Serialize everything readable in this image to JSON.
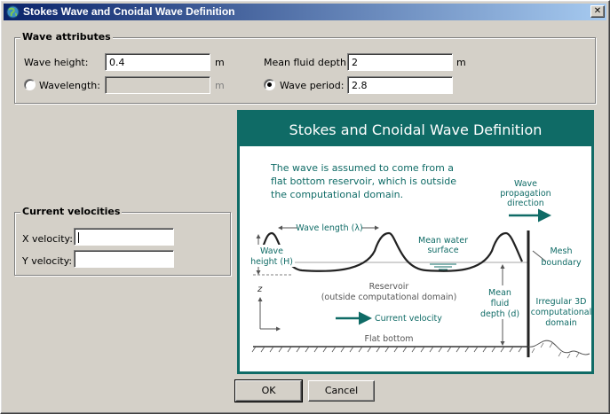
{
  "window": {
    "title": "Stokes Wave and Cnoidal Wave Definition",
    "close_glyph": "✕"
  },
  "wave_attributes": {
    "group_label": "Wave attributes",
    "wave_height": {
      "label": "Wave height:",
      "value": "0.4",
      "unit": "m"
    },
    "wavelength": {
      "label": "Wavelength:",
      "value": "",
      "unit": "m",
      "selected": false
    },
    "mean_fluid_depth": {
      "label": "Mean fluid depth:",
      "value": "2",
      "unit": "m"
    },
    "wave_period": {
      "label": "Wave period:",
      "value": "2.8",
      "selected": true
    }
  },
  "current_velocities": {
    "group_label": "Current velocities",
    "x_velocity": {
      "label": "X velocity:",
      "value": ""
    },
    "y_velocity": {
      "label": "Y velocity:",
      "value": ""
    }
  },
  "figure": {
    "title": "Stokes and Cnoidal Wave Definition",
    "description_lines": [
      "The wave is assumed to come from a",
      "flat bottom reservoir, which is outside",
      "the computational domain."
    ],
    "propagation_lines": [
      "Wave",
      "propagation",
      "direction"
    ],
    "wave_length_label": "Wave length (λ)",
    "mean_water_surface_lines": [
      "Mean water",
      "surface"
    ],
    "mesh_boundary_lines": [
      "Mesh",
      "boundary"
    ],
    "wave_height_lines": [
      "Wave",
      "height (H)"
    ],
    "reservoir_lines": [
      "Reservoir",
      "(outside computational domain)"
    ],
    "mean_fluid_depth_lines": [
      "Mean",
      "fluid",
      "depth (d)"
    ],
    "irregular_domain_lines": [
      "Irregular 3D",
      "computational",
      "domain"
    ],
    "axis_label": "z",
    "current_velocity_label": "Current velocity",
    "flat_bottom_label": "Flat bottom"
  },
  "buttons": {
    "ok": "OK",
    "cancel": "Cancel"
  },
  "colors": {
    "teal": "#0f6b66",
    "figure_text": "#4a4a4a"
  }
}
